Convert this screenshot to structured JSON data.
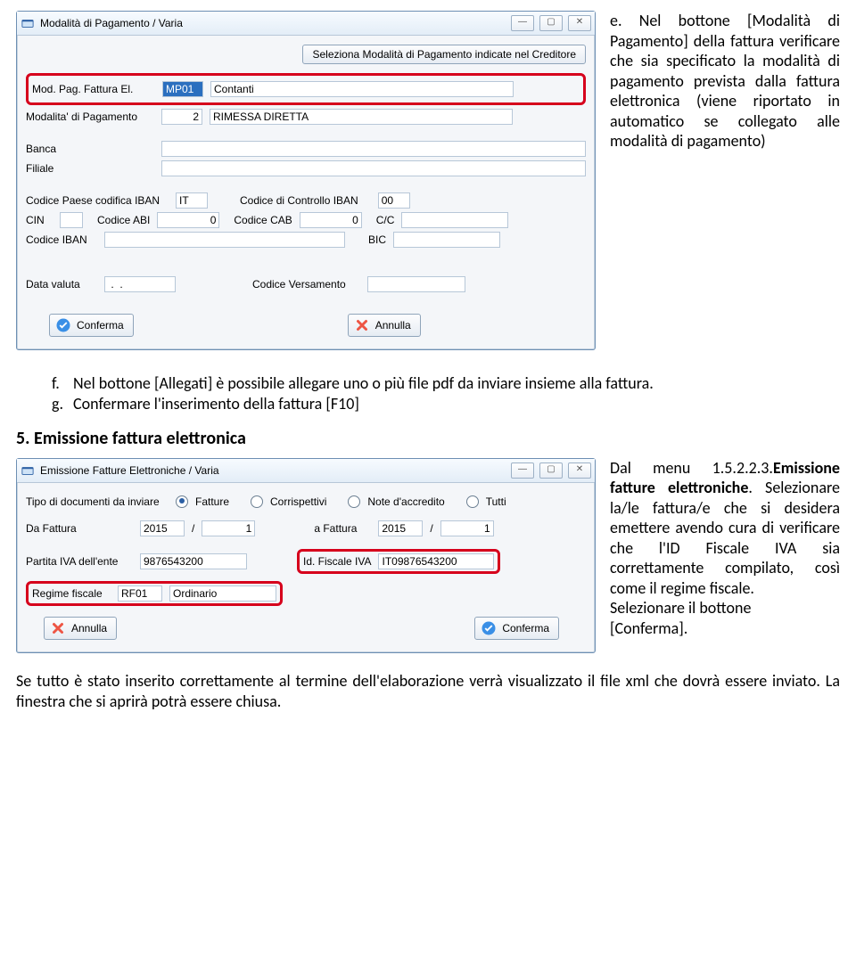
{
  "dialog1": {
    "title": "Modalità di Pagamento / Varia",
    "selectBtn": "Seleziona Modalità di Pagamento indicate nel Creditore",
    "labels": {
      "modPagFatturaEl": "Mod. Pag. Fattura El.",
      "mp01": "MP01",
      "contanti": "Contanti",
      "modalitaPag": "Modalita' di Pagamento",
      "modalitaPagCode": "2",
      "modalitaPagDesc": "RIMESSA DIRETTA",
      "banca": "Banca",
      "filiale": "Filiale",
      "codPaese": "Codice Paese codifica IBAN",
      "codPaeseVal": "IT",
      "codControllo": "Codice di Controllo IBAN",
      "codControlloVal": "00",
      "cin": "CIN",
      "codAbi": "Codice ABI",
      "codAbiVal": "0",
      "codCab": "Codice CAB",
      "codCabVal": "0",
      "cc": "C/C",
      "codIban": "Codice IBAN",
      "bic": "BIC",
      "dataValuta": "Data valuta",
      "dataValutaVal": " .  .",
      "codVersamento": "Codice Versamento",
      "conferma": "Conferma",
      "annulla": "Annulla"
    }
  },
  "rightNote1": {
    "lead_e": "e.",
    "text": "Nel bottone [Modalità di Pagamento] della fattura verificare che sia specificato la modalità di pagamento prevista dalla fattura elettronica (viene riportato in automatico se collegato alle modalità di pagamento)"
  },
  "midList": {
    "f_marker": "f.",
    "f_text": "Nel bottone [Allegati] è possibile allegare uno o più file pdf da inviare insieme alla fattura.",
    "g_marker": "g.",
    "g_text": "Confermare l'inserimento della fattura [F10]"
  },
  "section5": "5.   Emissione fattura elettronica",
  "dialog2": {
    "title": "Emissione Fatture Elettroniche / Varia",
    "labels": {
      "tipoDoc": "Tipo di documenti da inviare",
      "rFatture": "Fatture",
      "rCorr": "Corrispettivi",
      "rNote": "Note d'accredito",
      "rTutti": "Tutti",
      "daFattura": "Da Fattura",
      "daY": "2015",
      "daN": "1",
      "aFattura": "a Fattura",
      "aY": "2015",
      "aN": "1",
      "piva": "Partita IVA dell'ente",
      "pivaVal": "9876543200",
      "idFiscale": "Id. Fiscale IVA",
      "idFiscaleVal": "IT09876543200",
      "regime": "Regime fiscale",
      "regimeCode": "RF01",
      "regimeDesc": "Ordinario",
      "annulla": "Annulla",
      "conferma": "Conferma"
    }
  },
  "rightNote2": {
    "p1a": "Dal menu 1.5.2.2.3.",
    "p1b": "Emissione fatture elettroniche",
    "p1c": ". Selezionare la/le fattura/e che si desidera emettere avendo cura di verificare che l'ID Fiscale IVA sia correttamente compilato, così come il regime fiscale.",
    "p2": "Selezionare il bottone",
    "p3": "[Conferma]."
  },
  "bottomNote": "Se tutto è stato inserito correttamente al termine dell'elaborazione verrà visualizzato il file xml che dovrà essere inviato. La finestra che si aprirà potrà essere chiusa."
}
